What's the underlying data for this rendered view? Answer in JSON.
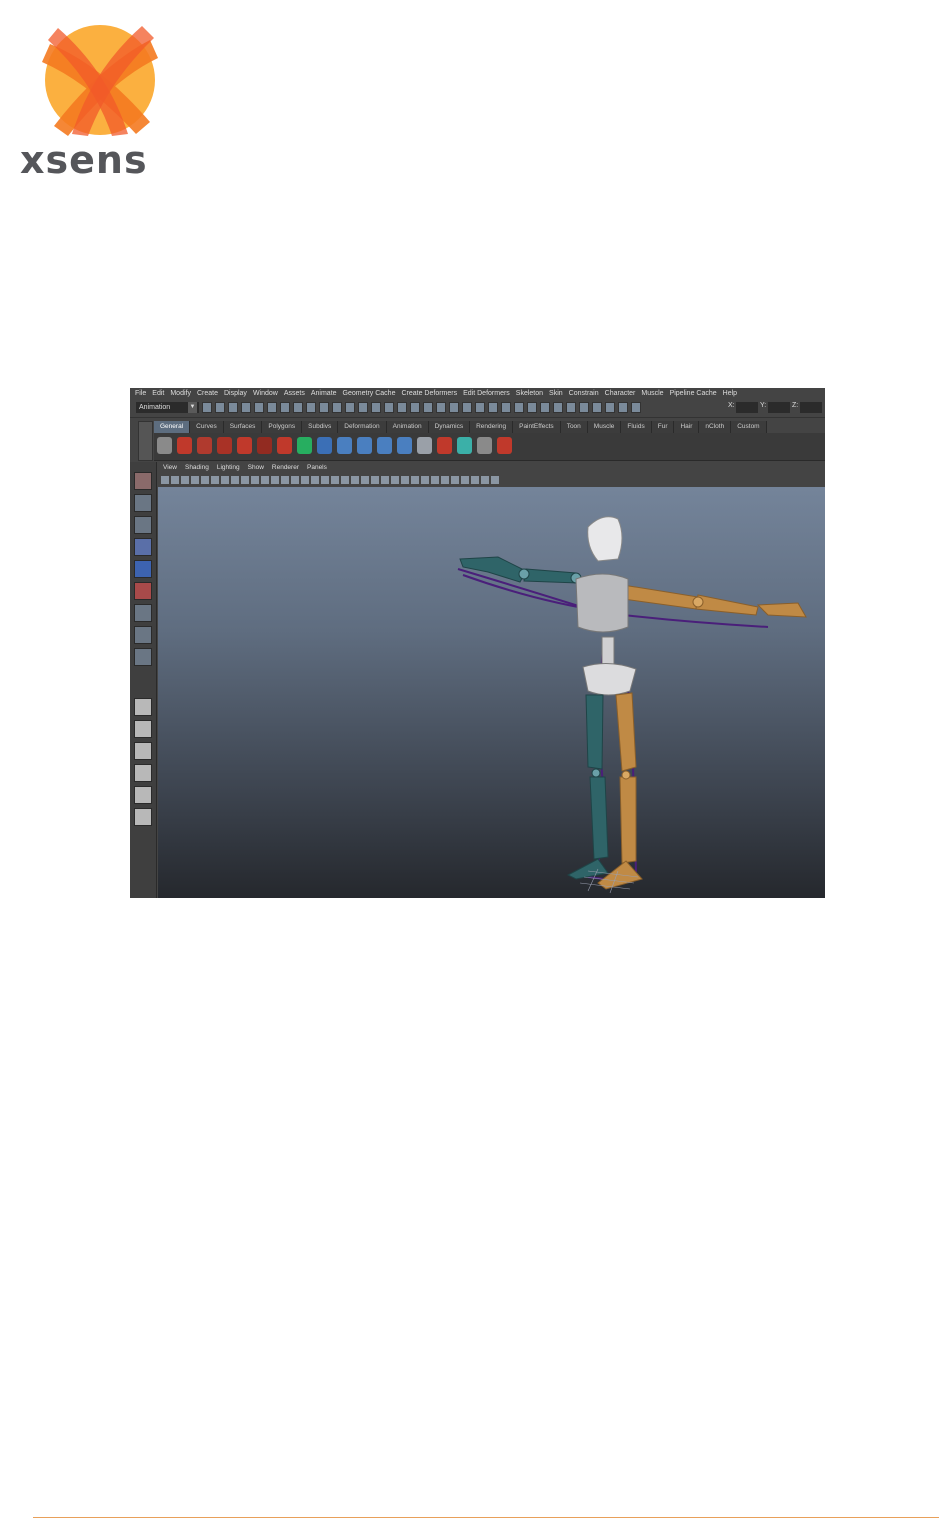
{
  "logo": {
    "wordmark": "xsens",
    "colors": {
      "orange": "#f47a20",
      "yellow": "#fbb040",
      "grey": "#55565a"
    }
  },
  "maya": {
    "menus": [
      "File",
      "Edit",
      "Modify",
      "Create",
      "Display",
      "Window",
      "Assets",
      "Animate",
      "Geometry Cache",
      "Create Deformers",
      "Edit Deformers",
      "Skeleton",
      "Skin",
      "Constrain",
      "Character",
      "Muscle",
      "Pipeline Cache",
      "Help"
    ],
    "mode_selector": "Animation",
    "coord_labels": [
      "X:",
      "Y:",
      "Z:"
    ],
    "shelf_tabs": [
      "General",
      "Curves",
      "Surfaces",
      "Polygons",
      "Subdivs",
      "Deformation",
      "Animation",
      "Dynamics",
      "Rendering",
      "PaintEffects",
      "Toon",
      "Muscle",
      "Fluids",
      "Fur",
      "Hair",
      "nCloth",
      "Custom"
    ],
    "active_shelf_tab": "General",
    "panel_menus": [
      "View",
      "Shading",
      "Lighting",
      "Show",
      "Renderer",
      "Panels"
    ],
    "colors": {
      "left_limbs": "#2f6468",
      "right_limbs": "#c08a45",
      "torso": "#c9cacc",
      "skeleton": "#4a1f7a"
    }
  },
  "footer": {
    "line_color": "#e8a05a"
  }
}
